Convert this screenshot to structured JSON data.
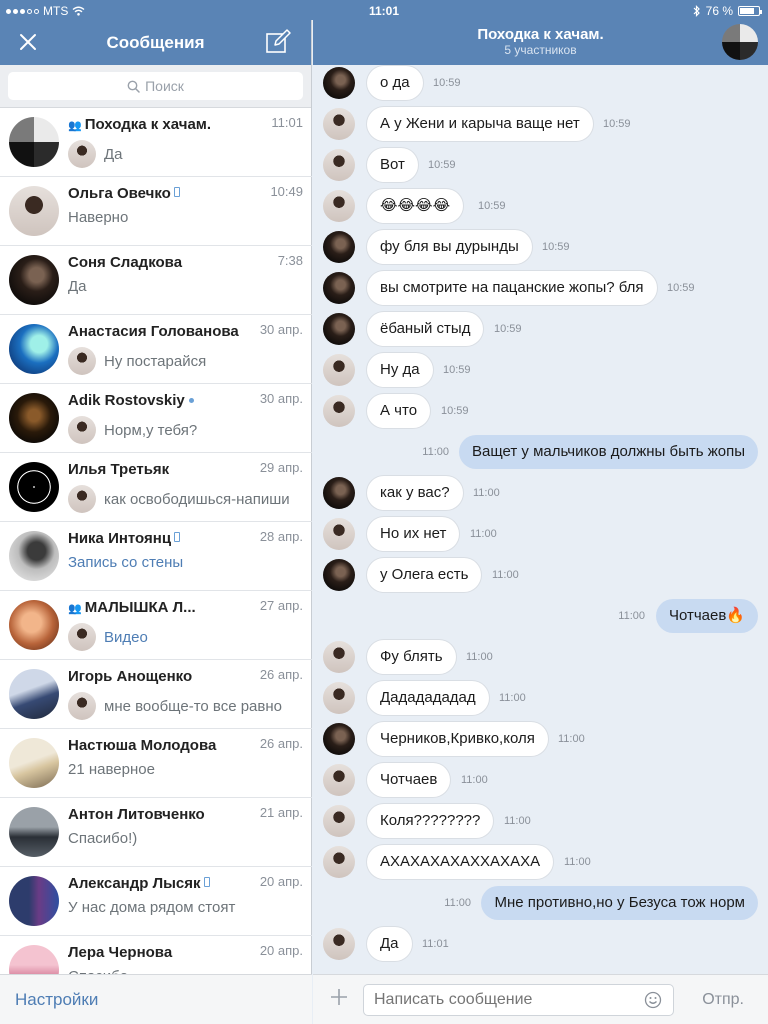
{
  "statusbar": {
    "carrier": "MTS",
    "time": "11:01",
    "battery": "76 %",
    "battery_level": 0.76
  },
  "left": {
    "title": "Сообщения",
    "search_placeholder": "Поиск",
    "settings_label": "Настройки",
    "conversations": [
      {
        "name": "Походка к хачам.",
        "time": "11:01",
        "preview": "Да",
        "group": true,
        "mini": true,
        "av": "grid"
      },
      {
        "name": "Ольга Овечко",
        "time": "10:49",
        "preview": "Наверно",
        "pin": true,
        "av": "light"
      },
      {
        "name": "Соня Сладкова",
        "time": "7:38",
        "preview": "Да",
        "av": "dark"
      },
      {
        "name": "Анастасия Голованова",
        "time": "30 апр.",
        "preview": "Ну постарайся",
        "mini": true,
        "av": "blue"
      },
      {
        "name": "Adik Rostovskiy",
        "time": "30 апр.",
        "preview": "Норм,у тебя?",
        "online": true,
        "mini": true,
        "av": "night"
      },
      {
        "name": "Илья Третьяк",
        "time": "29 апр.",
        "preview": "как освободишься-напиши",
        "mini": true,
        "av": "sigil"
      },
      {
        "name": "Ника Интоянц",
        "time": "28 апр.",
        "preview": "Запись со стены",
        "pin": true,
        "link": true,
        "av": "grey"
      },
      {
        "name": "МАЛЫШКА Л...",
        "time": "27 апр.",
        "preview": "Видео",
        "group": true,
        "mini": true,
        "link": true,
        "av": "warm"
      },
      {
        "name": "Игорь Анощенко",
        "time": "26 апр.",
        "preview": "мне вообще-то все равно",
        "mini": true,
        "av": "crowd"
      },
      {
        "name": "Настюша Молодова",
        "time": "26 апр.",
        "preview": "21 наверное",
        "av": "beige"
      },
      {
        "name": "Антон Литовченко",
        "time": "21 апр.",
        "preview": "Спасибо!)",
        "av": "car"
      },
      {
        "name": "Александр Лысяк",
        "time": "20 апр.",
        "preview": "У нас дома рядом стоят",
        "pin": true,
        "av": "pair"
      },
      {
        "name": "Лера Чернова",
        "time": "20 апр.",
        "preview": "Спасибо",
        "av": "pink"
      }
    ]
  },
  "chat": {
    "title": "Походка к хачам.",
    "subtitle": "5 участников",
    "composer_placeholder": "Написать сообщение",
    "send_label": "Отпр.",
    "messages": [
      {
        "dir": "in",
        "av": "dark",
        "text": "о да",
        "time": "10:59"
      },
      {
        "dir": "in",
        "av": "light",
        "text": "А у Жени и карыча ваще нет",
        "time": "10:59"
      },
      {
        "dir": "in",
        "av": "light",
        "text": "Вот",
        "time": "10:59"
      },
      {
        "dir": "in",
        "av": "light",
        "text": "😂😂😂😂",
        "time": "10:59"
      },
      {
        "dir": "in",
        "av": "dark",
        "text": "фу бля вы дурынды",
        "time": "10:59"
      },
      {
        "dir": "in",
        "av": "dark",
        "text": "вы смотрите на пацанские жопы? бля",
        "time": "10:59"
      },
      {
        "dir": "in",
        "av": "dark",
        "text": "ёбаный стыд",
        "time": "10:59"
      },
      {
        "dir": "in",
        "av": "light",
        "text": "Ну да",
        "time": "10:59"
      },
      {
        "dir": "in",
        "av": "light",
        "text": "А что",
        "time": "10:59"
      },
      {
        "dir": "out",
        "text": "Ващет у мальчиков должны быть жопы",
        "time": "11:00"
      },
      {
        "dir": "in",
        "av": "dark",
        "text": "как у вас?",
        "time": "11:00"
      },
      {
        "dir": "in",
        "av": "light",
        "text": "Но их нет",
        "time": "11:00"
      },
      {
        "dir": "in",
        "av": "dark",
        "text": "у Олега есть",
        "time": "11:00"
      },
      {
        "dir": "out",
        "text": "Чотчаев🔥",
        "time": "11:00"
      },
      {
        "dir": "in",
        "av": "light",
        "text": "Фу блять",
        "time": "11:00"
      },
      {
        "dir": "in",
        "av": "light",
        "text": "Дададададад",
        "time": "11:00"
      },
      {
        "dir": "in",
        "av": "dark",
        "text": "Черников,Кривко,коля",
        "time": "11:00"
      },
      {
        "dir": "in",
        "av": "light",
        "text": "Чотчаев",
        "time": "11:00"
      },
      {
        "dir": "in",
        "av": "light",
        "text": "Коля????????",
        "time": "11:00"
      },
      {
        "dir": "in",
        "av": "light",
        "text": "АХАХАХАХАХХАХАХА",
        "time": "11:00"
      },
      {
        "dir": "out",
        "text": "Мне противно,но у Безуса тож норм",
        "time": "11:00"
      },
      {
        "dir": "in",
        "av": "light",
        "text": "Да",
        "time": "11:01"
      }
    ]
  },
  "colors": {
    "header": "#5a84b5",
    "accent": "#4e7db4",
    "outgoing": "#c8daf1",
    "chat_bg": "#e8eef5"
  },
  "icons": [
    "close-icon",
    "compose-icon",
    "search-icon",
    "attach-icon",
    "smile-icon",
    "bluetooth-icon",
    "wifi-icon",
    "battery-icon",
    "group-icon",
    "phone-icon"
  ]
}
